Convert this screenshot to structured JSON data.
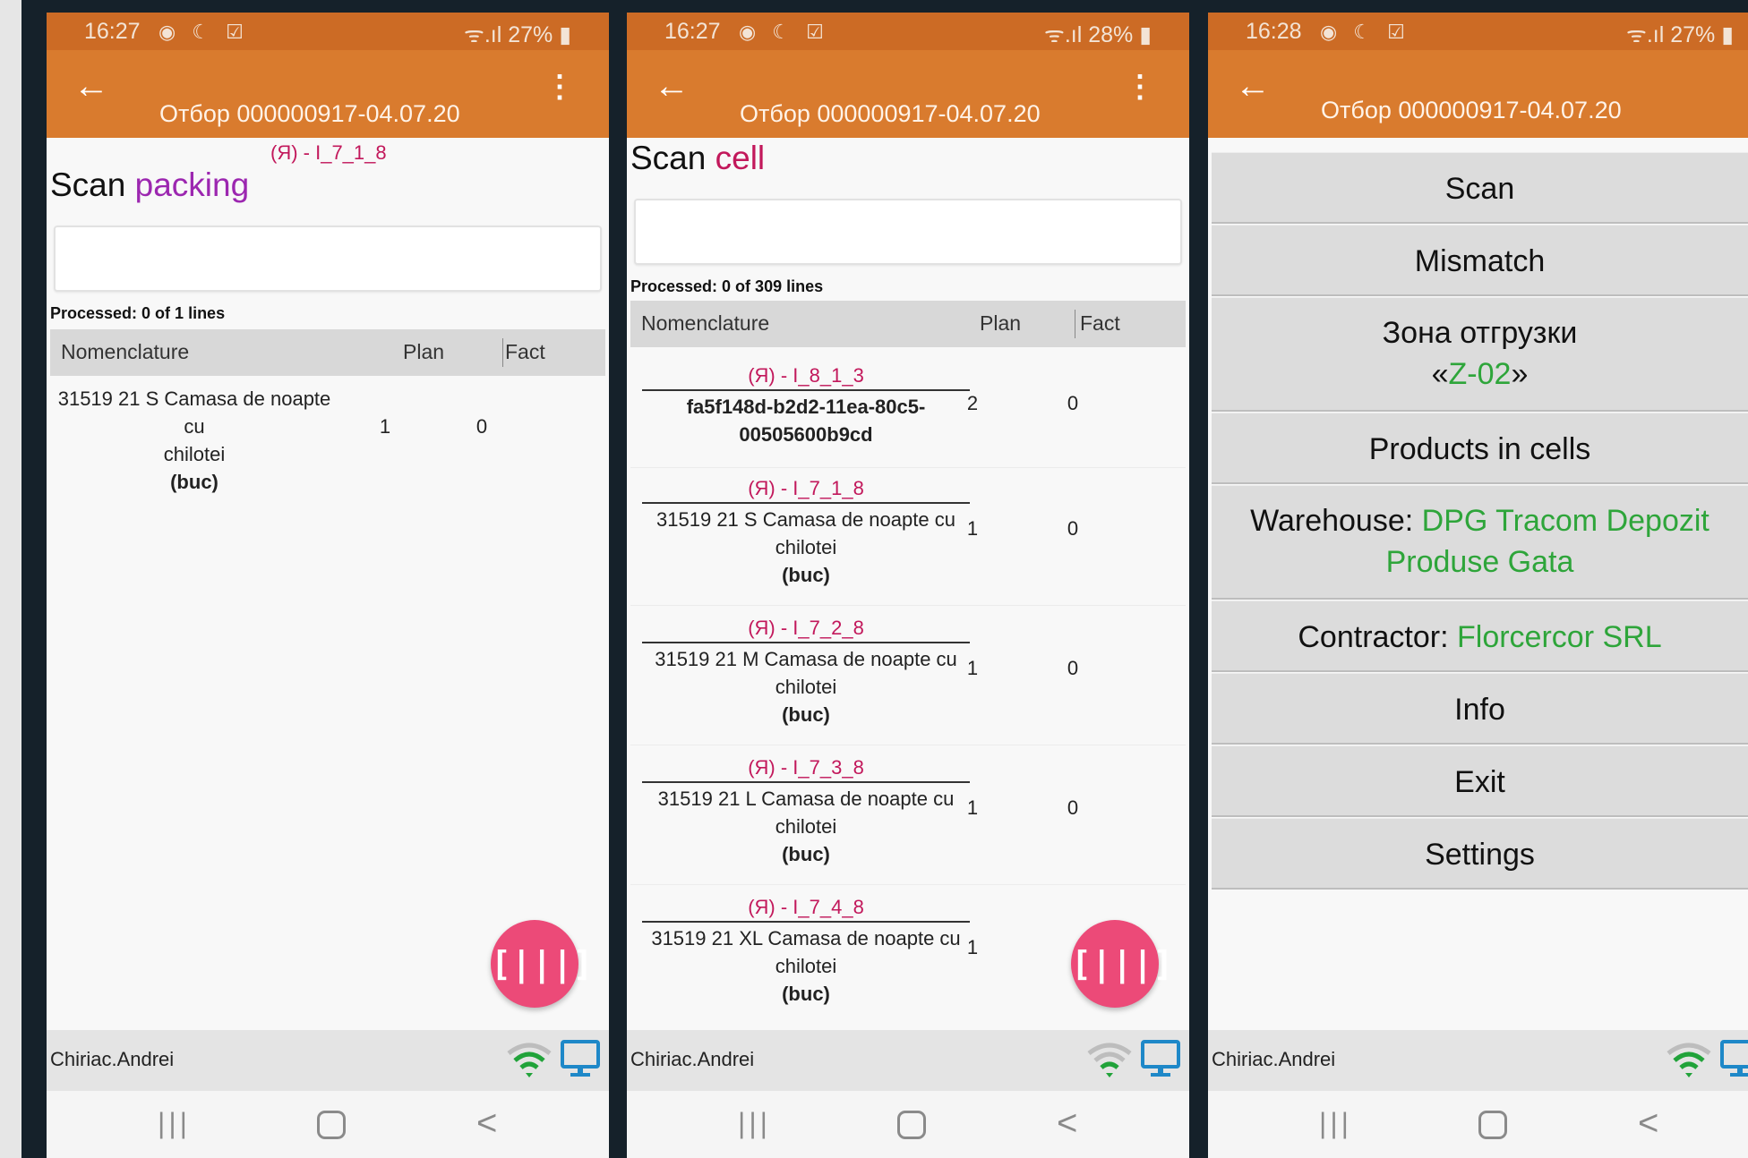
{
  "status": {
    "p1": {
      "time": "16:27",
      "icons": "◉ ☾ ☑",
      "right": "ᯤ.ıl 27% ▮"
    },
    "p2": {
      "time": "16:27",
      "icons": "◉ ☾ ☑",
      "right": "ᯤ.ıl 28% ▮"
    },
    "p3": {
      "time": "16:28",
      "icons": "◉ ☾ ☑",
      "right": "ᯤ.ıl 27% ▮"
    }
  },
  "app_title": "Отбор 000000917-04.07.20",
  "screen1": {
    "cell_code": "(Я) - I_7_1_8",
    "scan_prefix": "Scan ",
    "scan_target": "packing",
    "processed": "Processed: 0 of 1 lines",
    "columns": {
      "nomenclature": "Nomenclature",
      "plan": "Plan",
      "fact": "Fact"
    },
    "rows": [
      {
        "line1": "31519 21 S Camasa de noapte cu",
        "line2": "chilotei",
        "unit": "(buc)",
        "plan": "1",
        "fact": "0"
      }
    ]
  },
  "screen2": {
    "scan_prefix": "Scan ",
    "scan_target": "cell",
    "processed": "Processed: 0 of 309 lines",
    "columns": {
      "nomenclature": "Nomenclature",
      "plan": "Plan",
      "fact": "Fact"
    },
    "rows": [
      {
        "cell": "(Я) - I_8_1_3",
        "line1": "fa5f148d-b2d2-11ea-80c5-",
        "line2": "00505600b9cd",
        "unit": "",
        "plan": "2",
        "fact": "0"
      },
      {
        "cell": "(Я) - I_7_1_8",
        "line1": "31519 21 S Camasa de noapte cu",
        "line2": "chilotei",
        "unit": "(buc)",
        "plan": "1",
        "fact": "0"
      },
      {
        "cell": "(Я) - I_7_2_8",
        "line1": "31519 21 M Camasa de noapte cu",
        "line2": "chilotei",
        "unit": "(buc)",
        "plan": "1",
        "fact": "0"
      },
      {
        "cell": "(Я) - I_7_3_8",
        "line1": "31519 21 L Camasa de noapte cu",
        "line2": "chilotei",
        "unit": "(buc)",
        "plan": "1",
        "fact": "0"
      },
      {
        "cell": "(Я) - I_7_4_8",
        "line1": "31519 21 XL Camasa de noapte cu",
        "line2": "chilotei",
        "unit": "(buc)",
        "plan": "1",
        "fact": ""
      }
    ]
  },
  "screen3": {
    "menu": {
      "scan": "Scan",
      "mismatch": "Mismatch",
      "zone_label": "Зона отгрузки",
      "zone_open": "«",
      "zone_value": "Z-02",
      "zone_close": "»",
      "products_in_cells": "Products in cells",
      "warehouse_label": "Warehouse: ",
      "warehouse_value_1": "DPG Tracom Depozit",
      "warehouse_value_2": "Produse Gata",
      "contractor_label": "Contractor: ",
      "contractor_value": "Florcercor SRL",
      "info": "Info",
      "exit": "Exit",
      "settings": "Settings"
    }
  },
  "footer": {
    "user": "Chiriac.Andrei"
  },
  "icons": {
    "back": "arrow-left-icon",
    "menu": "more-vert-icon",
    "fab": "barcode-scan-icon",
    "wifi": "wifi-icon",
    "monitor": "monitor-icon",
    "nav_recent": "recent-apps-icon",
    "nav_home": "home-icon",
    "nav_back": "nav-back-icon"
  },
  "glyphs": {
    "back": "←",
    "menu": "⋮",
    "fab": "[|||]",
    "nav_recent": "|||",
    "nav_back": "<"
  },
  "colors": {
    "appbar": "#d97b2e",
    "statusbar": "#cc6b25",
    "accent_pink": "#ec4a78",
    "cell_code": "#c2185b",
    "packing": "#9c27b0",
    "green_value": "#2ea53a",
    "wifi_green": "#21a33a",
    "monitor_blue": "#1e88c8"
  }
}
